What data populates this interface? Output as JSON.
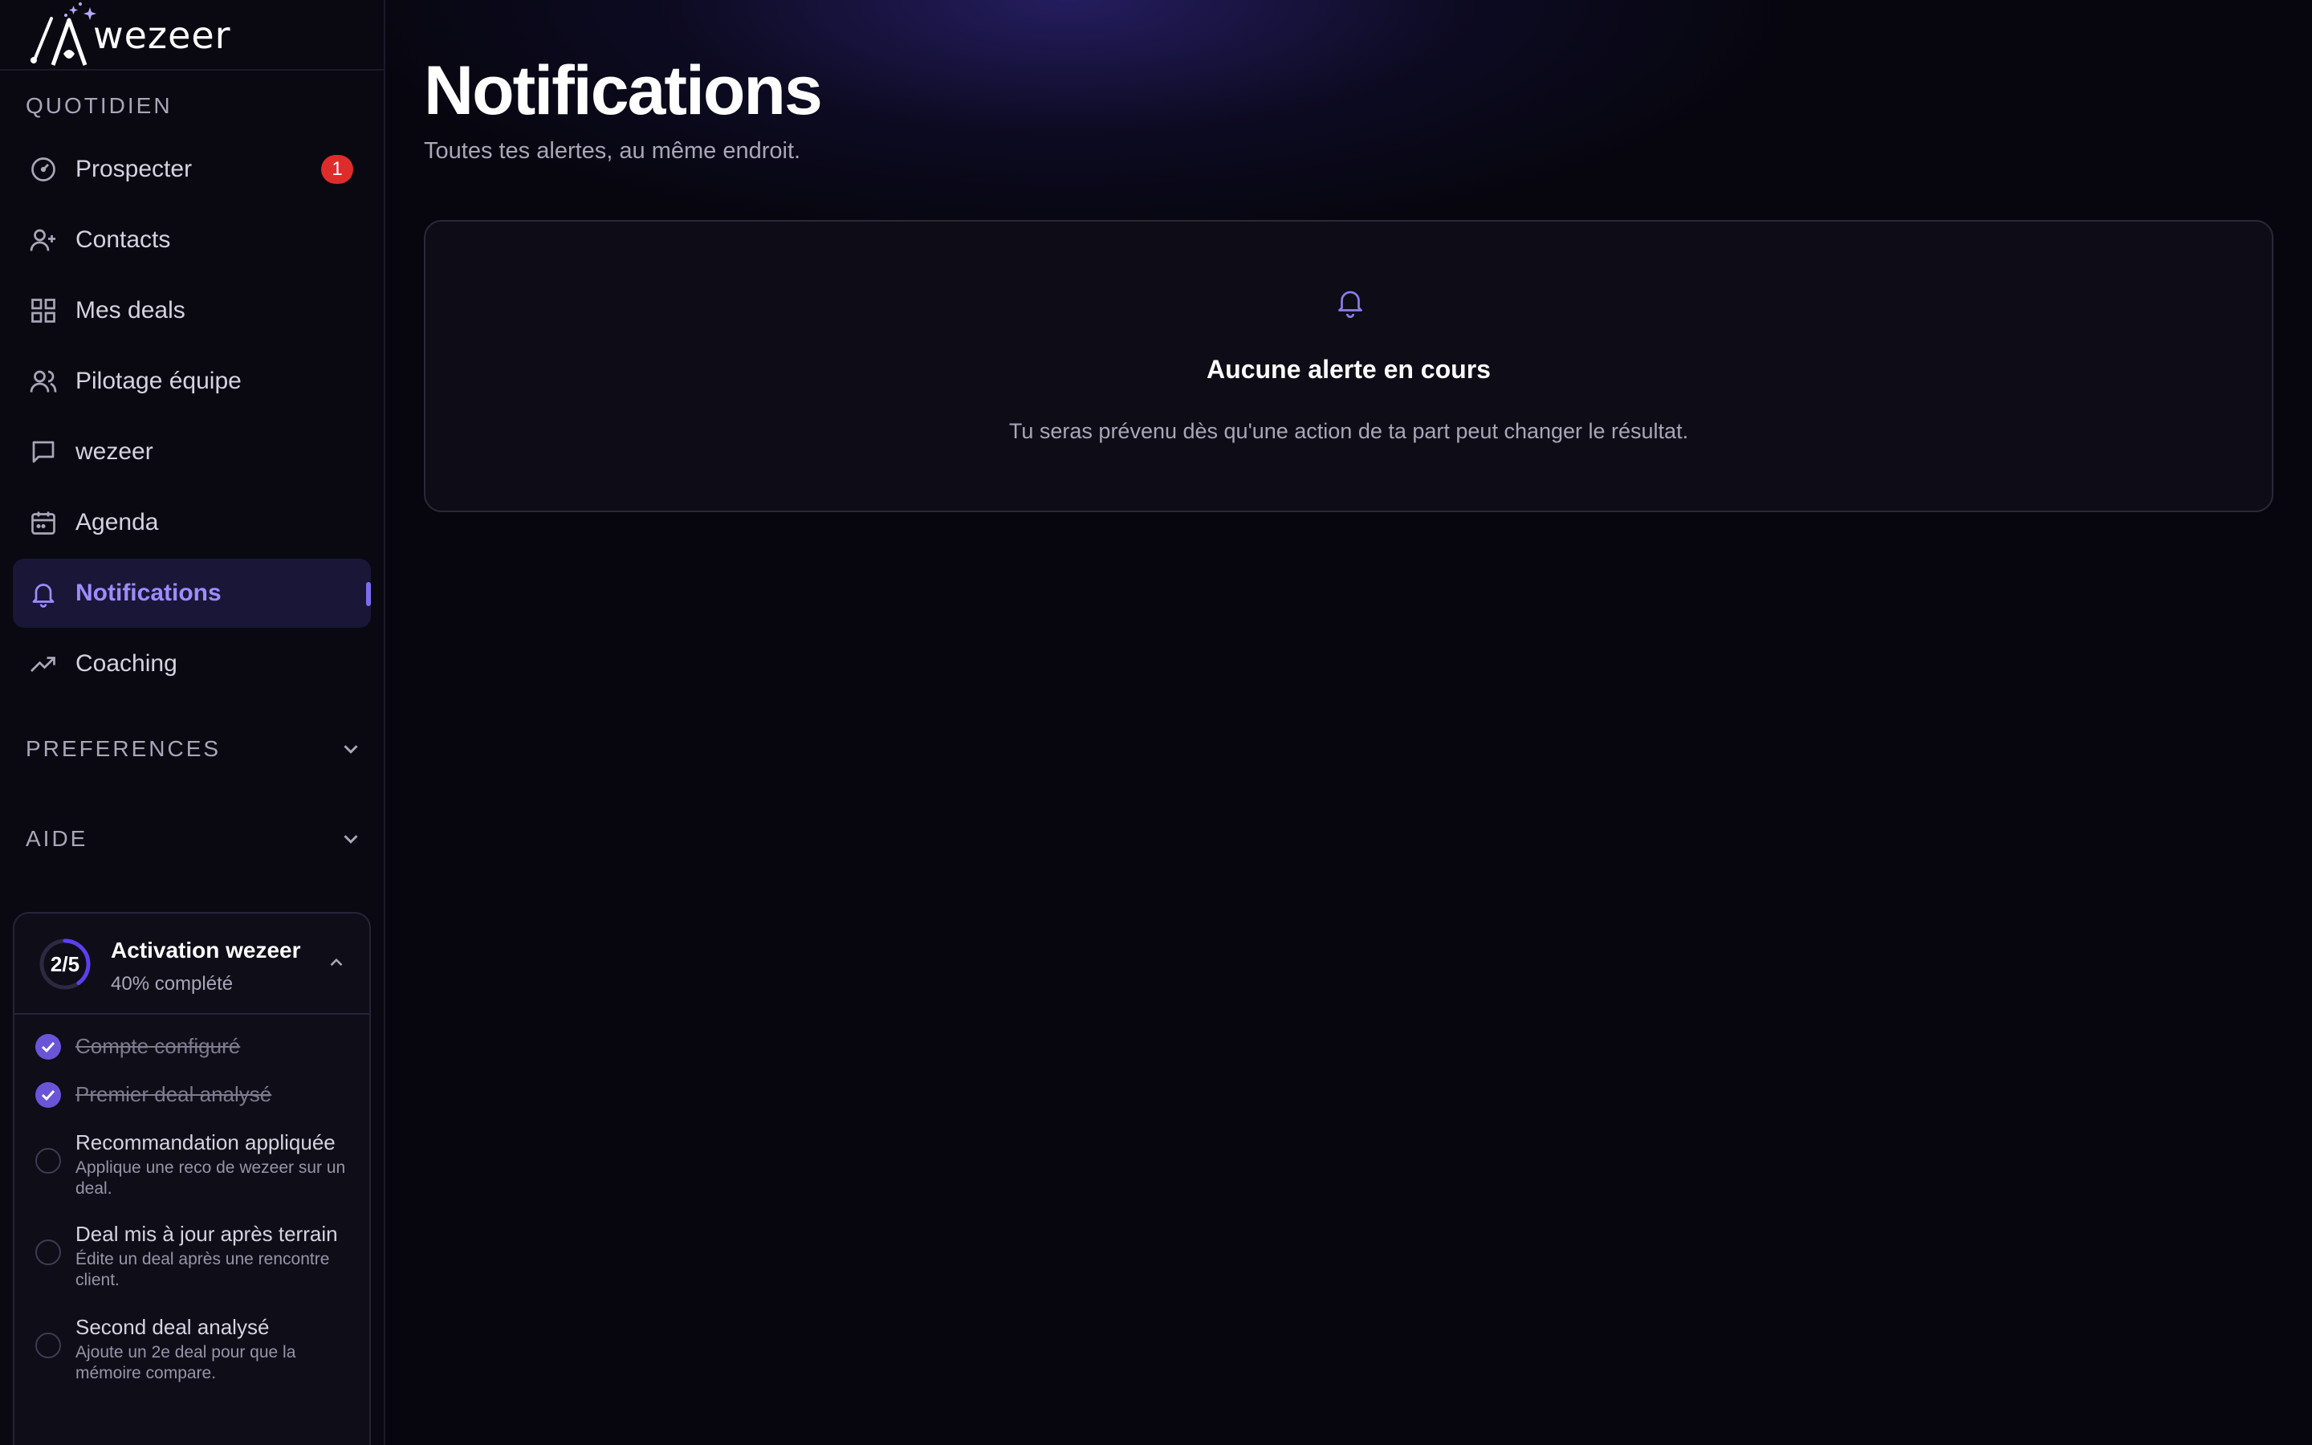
{
  "brand": {
    "name": "wezeer"
  },
  "sidebar": {
    "section_daily": "QUOTIDIEN",
    "items": [
      {
        "label": "Prospecter",
        "icon": "gauge-icon",
        "badge": "1"
      },
      {
        "label": "Contacts",
        "icon": "user-plus-icon"
      },
      {
        "label": "Mes deals",
        "icon": "grid-icon"
      },
      {
        "label": "Pilotage équipe",
        "icon": "users-icon"
      },
      {
        "label": "wezeer",
        "icon": "chat-icon"
      },
      {
        "label": "Agenda",
        "icon": "calendar-icon"
      },
      {
        "label": "Notifications",
        "icon": "bell-icon",
        "active": true
      },
      {
        "label": "Coaching",
        "icon": "trending-up-icon"
      }
    ],
    "section_preferences": "PREFERENCES",
    "section_help": "AIDE"
  },
  "activation": {
    "progress": "2/5",
    "progress_fraction": 0.4,
    "title": "Activation wezeer",
    "subtitle": "40% complété",
    "tasks": [
      {
        "title": "Compte configuré",
        "done": true
      },
      {
        "title": "Premier deal analysé",
        "done": true
      },
      {
        "title": "Recommandation appliquée",
        "desc": "Applique une reco de wezeer sur un deal.",
        "done": false
      },
      {
        "title": "Deal mis à jour après terrain",
        "desc": "Édite un deal après une rencontre client.",
        "done": false
      },
      {
        "title": "Second deal analysé",
        "desc": "Ajoute un 2e deal pour que la mémoire compare.",
        "done": false
      }
    ]
  },
  "main": {
    "title": "Notifications",
    "subtitle": "Toutes tes alertes, au même endroit.",
    "empty": {
      "title": "Aucune alerte en cours",
      "desc": "Tu seras prévenu dès qu'une action de ta part peut changer le résultat."
    }
  },
  "colors": {
    "accent": "#7c6cf0",
    "badge": "#e02b2b",
    "background": "#07060f"
  }
}
